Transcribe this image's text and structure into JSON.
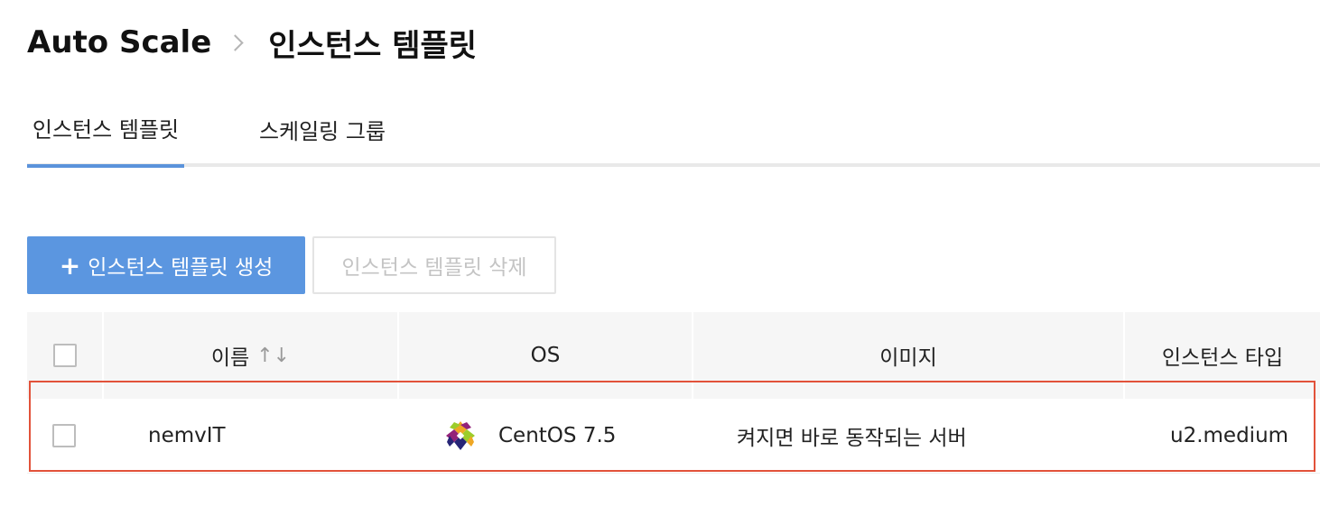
{
  "breadcrumb": {
    "parent": "Auto Scale",
    "current": "인스턴스 템플릿"
  },
  "tabs": [
    {
      "label": "인스턴스 템플릿",
      "active": true
    },
    {
      "label": "스케일링 그룹",
      "active": false
    }
  ],
  "toolbar": {
    "create_icon": "+",
    "create_label": "인스턴스 템플릿 생성",
    "delete_label": "인스턴스 템플릿 삭제"
  },
  "table": {
    "headers": {
      "name": "이름",
      "name_sort_icon": "↑↓",
      "os": "OS",
      "image": "이미지",
      "instance_type": "인스턴스 타입"
    },
    "rows": [
      {
        "name": "nemvIT",
        "os": "CentOS 7.5",
        "os_icon": "centos-logo-icon",
        "image": "켜지면 바로 동작되는 서버",
        "instance_type": "u2.medium",
        "checked": false
      }
    ]
  },
  "colors": {
    "accent": "#5b96e0",
    "highlight": "#e2523a"
  }
}
